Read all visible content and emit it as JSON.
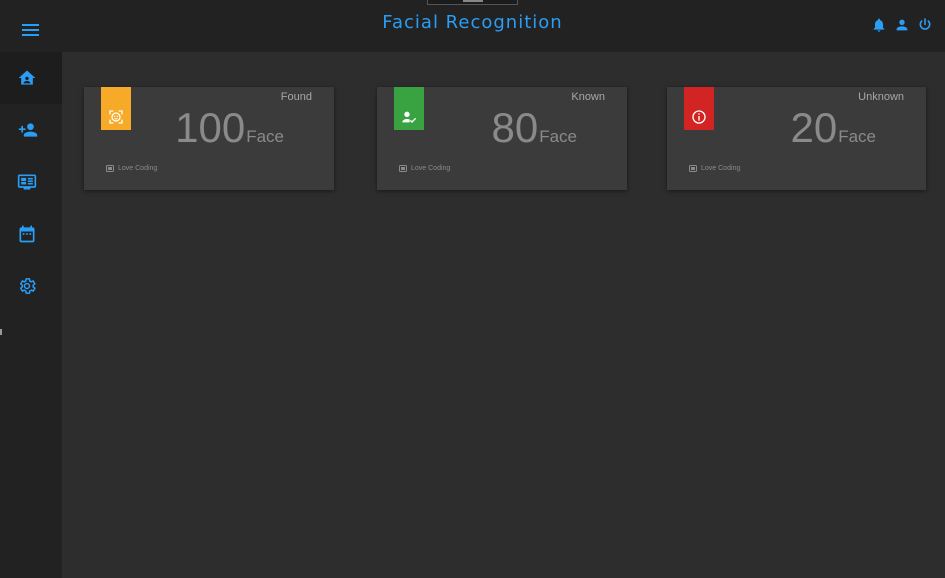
{
  "header": {
    "title": "Facial Recognition"
  },
  "sidebar": {
    "items": [
      {
        "name": "home",
        "icon": "home-icon",
        "active": true
      },
      {
        "name": "add-person",
        "icon": "person-add-icon",
        "active": false
      },
      {
        "name": "monitor",
        "icon": "monitor-icon",
        "active": false
      },
      {
        "name": "calendar",
        "icon": "calendar-icon",
        "active": false
      },
      {
        "name": "settings",
        "icon": "gear-icon",
        "active": false
      }
    ]
  },
  "cards": [
    {
      "label": "Found",
      "value": "100",
      "unit": "Face",
      "footer": "Love Coding",
      "color": "#f7a928",
      "icon": "face-scan-icon"
    },
    {
      "label": "Known",
      "value": "80",
      "unit": "Face",
      "footer": "Love Coding",
      "color": "#3aa341",
      "icon": "person-check-icon"
    },
    {
      "label": "Unknown",
      "value": "20",
      "unit": "Face",
      "footer": "Love Coding",
      "color": "#d32424",
      "icon": "info-icon"
    }
  ],
  "colors": {
    "accent": "#2a9df4",
    "topbar": "#222222",
    "sidebar": "#222222",
    "content": "#2d2d2d",
    "card": "#3b3b3b"
  }
}
